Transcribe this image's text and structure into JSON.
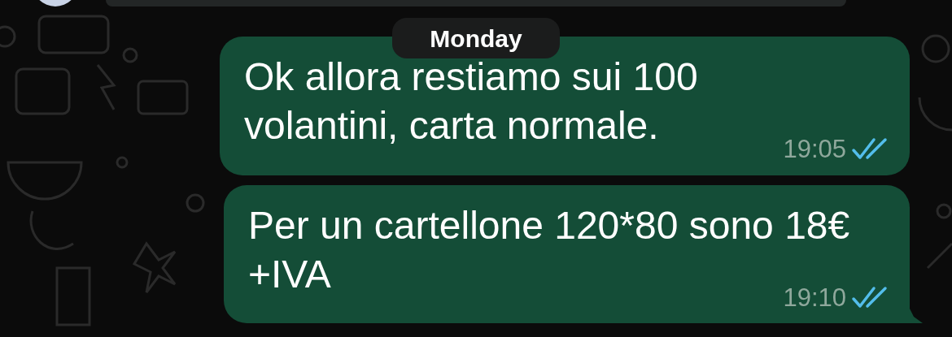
{
  "date_label": "Monday",
  "messages": [
    {
      "text": "Ok allora restiamo sui 100 volantini, carta normale.",
      "time": "19:05",
      "read": true,
      "tail": false
    },
    {
      "text": "Per un cartellone 120*80 sono 18€ +IVA",
      "time": "19:10",
      "read": true,
      "tail": true
    }
  ]
}
